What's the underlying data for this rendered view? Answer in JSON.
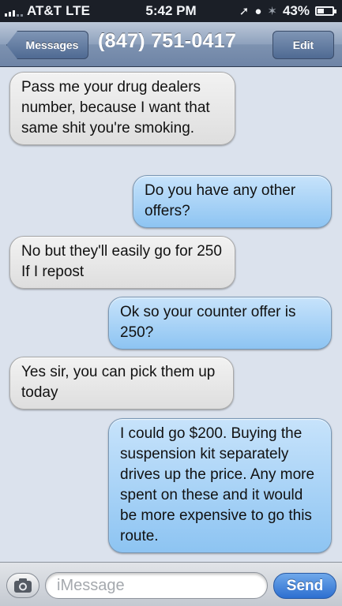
{
  "status_bar": {
    "carrier": "AT&T",
    "network": "LTE",
    "time": "5:42 PM",
    "battery": "43%",
    "battery_level": 0.43,
    "icons": [
      "location-arrow-icon",
      "rotation-lock-icon",
      "bluetooth-icon"
    ]
  },
  "nav": {
    "back_label": "Messages",
    "title": "(847) 751-0417",
    "edit_label": "Edit"
  },
  "messages": [
    {
      "direction": "in",
      "text": "Pass me your drug dealers number, because I want that same shit you're smoking."
    },
    {
      "direction": "out",
      "text": "Do you have any other offers?"
    },
    {
      "direction": "in",
      "text": "No but they'll easily go for 250 If I repost"
    },
    {
      "direction": "out",
      "text": "Ok so your counter offer is 250?"
    },
    {
      "direction": "in",
      "text": "Yes sir, you can pick them up today"
    },
    {
      "direction": "out",
      "text": "I could go $200. Buying the suspension kit separately drives up the price. Any more spent on these and it would be more expensive to go this route."
    }
  ],
  "input_bar": {
    "placeholder": "iMessage",
    "send_label": "Send",
    "camera_icon": "camera-icon"
  },
  "colors": {
    "background": "#dbe2ed",
    "incoming_bubble": "#e6e6e6",
    "outgoing_bubble": "#a9d2f6",
    "send_button": "#3d7fdc"
  }
}
